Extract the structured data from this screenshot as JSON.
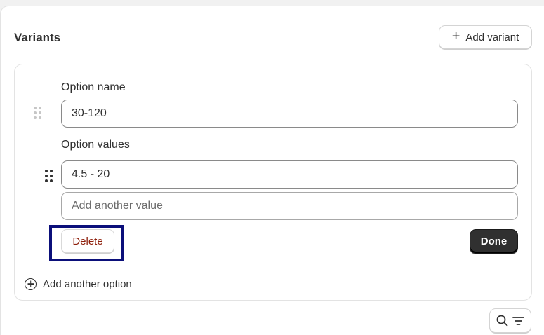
{
  "variants": {
    "title": "Variants",
    "add_variant_label": "Add variant"
  },
  "option": {
    "name_label": "Option name",
    "name_value": "30-120",
    "values_label": "Option values",
    "values": [
      "4.5 - 20"
    ],
    "new_value_placeholder": "Add another value",
    "delete_label": "Delete",
    "done_label": "Done"
  },
  "add_option_label": "Add another option",
  "icons": {
    "add": "plus-icon",
    "drag": "drag-handle-icon",
    "add_option": "plus-circle-icon",
    "search": "search-icon",
    "filter": "filter-icon"
  },
  "colors": {
    "delete_text": "#8e1f0b",
    "primary_button": "#303030",
    "highlight_box": "#0b0f7a"
  }
}
